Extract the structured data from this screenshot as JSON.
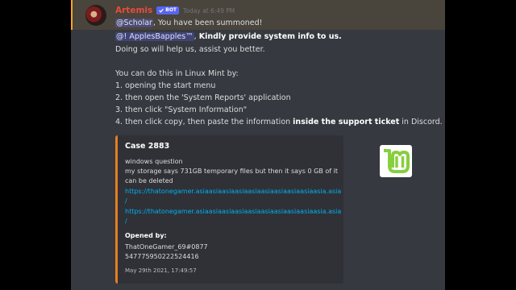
{
  "message": {
    "author": "Artemis",
    "bot_tag": "BOT",
    "timestamp": "Today at 6:49 PM",
    "mention_line": {
      "mention": "@Scholar",
      "rest": ", You have been summoned!"
    },
    "request_line": {
      "mention": "@! ApplesBapples™",
      "comma": ", ",
      "bold": "Kindly provide system info to us."
    },
    "help_line": "Doing so will help us, assist you better.",
    "linux_intro": "You can do this in Linux Mint by:",
    "steps": [
      "1. opening the start menu",
      "2. then open the 'System Reports' application",
      "3. then click \"System Information\""
    ],
    "step4": {
      "pre": "4. then click copy, then paste the information ",
      "bold": "inside the support ticket",
      "post": " in Discord. \""
    }
  },
  "embed": {
    "accent_color": "#e67e22",
    "title": "Case 2883",
    "desc_lines": [
      "windows question",
      "my storage says 731GB temporary files but then it says 0 GB of it",
      "can be deleted"
    ],
    "links": [
      "https://thatonegamer.asiaasiaasiaasiaasiaasiaasiaasiaasiaasia.asia",
      "/",
      "https://thatonegamer.asiaasiaasiaasiaasiaasiaasiaasiaasiaasia.asia",
      "/"
    ],
    "field_name": "Opened by:",
    "field_values": [
      "ThatOneGamer_69#0877",
      "547775950222524416"
    ],
    "footer": "May 29th 2021, 17:49:57",
    "thumbnail_icon": "linux-mint-logo"
  }
}
